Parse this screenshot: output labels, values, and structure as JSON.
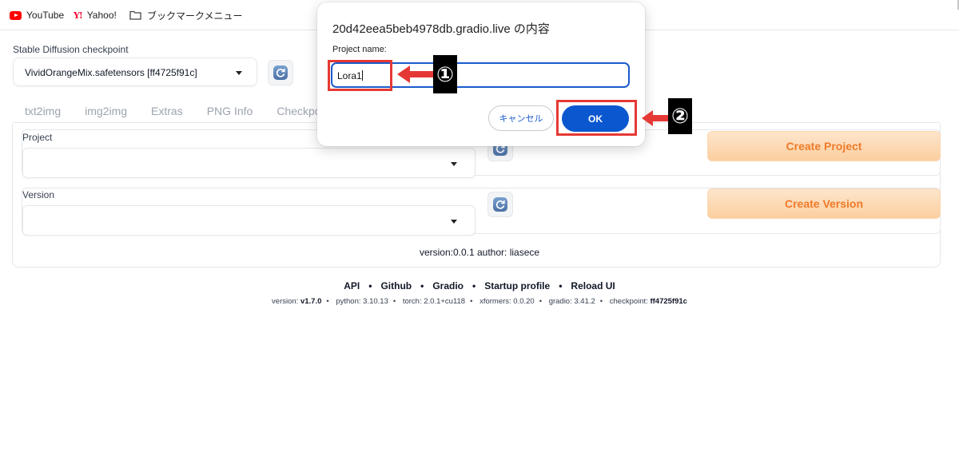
{
  "bookmarks": [
    {
      "label": "YouTube",
      "icon": "youtube-icon"
    },
    {
      "label": "Yahoo!",
      "icon": "yahoo-icon"
    },
    {
      "label": "ブックマークメニュー",
      "icon": "folder-icon"
    }
  ],
  "checkpoint": {
    "label": "Stable Diffusion checkpoint",
    "value": "VividOrangeMix.safetensors [ff4725f91c]"
  },
  "tabs": [
    "txt2img",
    "img2img",
    "Extras",
    "PNG Info",
    "Checkpo"
  ],
  "project": {
    "label": "Project",
    "value": "",
    "button": "Create Project"
  },
  "version": {
    "label": "Version",
    "value": "",
    "button": "Create Version"
  },
  "ext_info": "version:0.0.1 author: liasece",
  "footer": {
    "links": [
      "API",
      "Github",
      "Gradio",
      "Startup profile",
      "Reload UI"
    ],
    "info": [
      {
        "key": "version: ",
        "value": "v1.7.0"
      },
      {
        "key": "python: ",
        "value": "3.10.13"
      },
      {
        "key": "torch: ",
        "value": "2.0.1+cu118"
      },
      {
        "key": "xformers: ",
        "value": "0.0.20"
      },
      {
        "key": "gradio: ",
        "value": "3.41.2"
      },
      {
        "key": "checkpoint: ",
        "value": "ff4725f91c"
      }
    ]
  },
  "dialog": {
    "title": "20d42eea5beb4978db.gradio.live の内容",
    "label": "Project name:",
    "input_value": "Lora1",
    "cancel": "キャンセル",
    "ok": "OK"
  },
  "annotations": {
    "step1": "①",
    "step2": "②",
    "color": "#e53935"
  },
  "colors": {
    "accent": "#0b57d0",
    "orange": "#f07a2a"
  }
}
